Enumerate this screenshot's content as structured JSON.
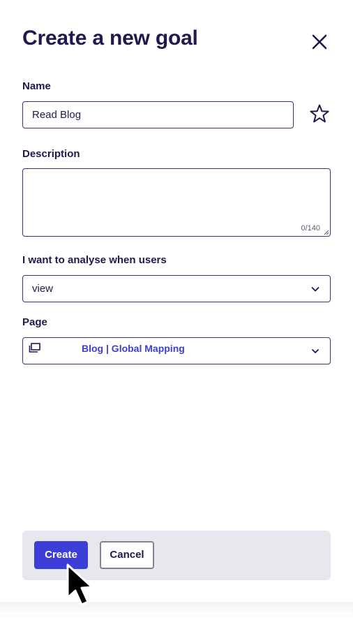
{
  "dialog": {
    "title": "Create a new goal",
    "close_icon": "close-icon"
  },
  "name": {
    "label": "Name",
    "value": "Read Blog",
    "favorite_icon": "star-outline-icon"
  },
  "description": {
    "label": "Description",
    "value": "",
    "counter": "0/140"
  },
  "analyse": {
    "label": "I want to analyse when users",
    "selected": "view",
    "icon": "chevron-down-icon"
  },
  "page": {
    "label": "Page",
    "selected": "Blog | Global Mapping",
    "icon": "page-copy-icon",
    "chevron_icon": "chevron-down-icon"
  },
  "footer": {
    "create_label": "Create",
    "cancel_label": "Cancel"
  },
  "colors": {
    "primary": "#3b3fd8",
    "text": "#1f1a4d",
    "link": "#3b3fd1",
    "footer_bg": "#e6e8ed"
  }
}
